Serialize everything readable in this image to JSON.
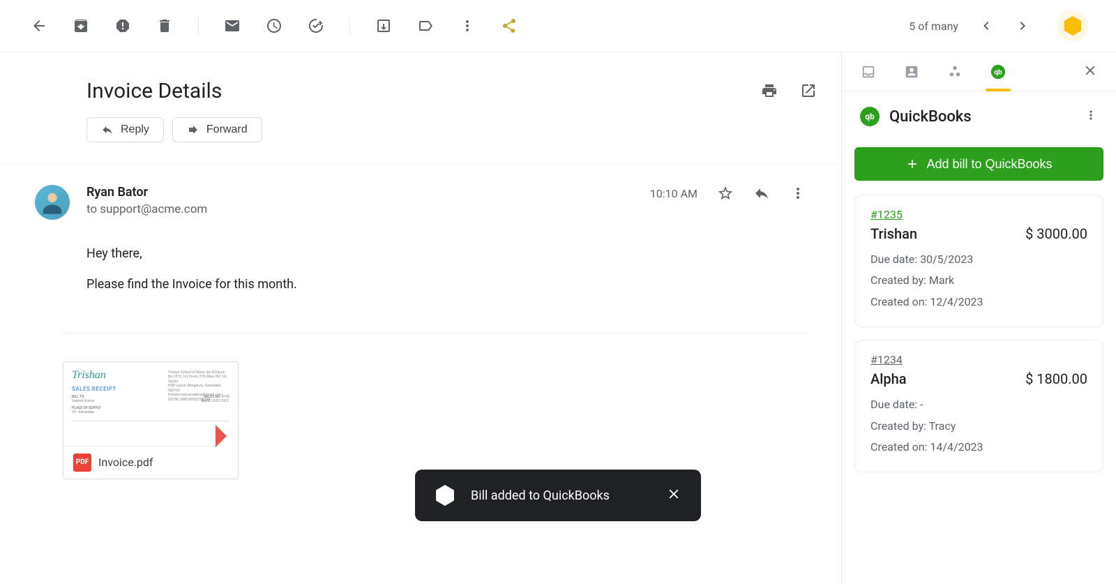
{
  "toolbar": {
    "counter": "5 of many"
  },
  "email": {
    "subject": "Invoice Details",
    "reply_label": "Reply",
    "forward_label": "Forward",
    "sender_name": "Ryan Bator",
    "recipient": "to support@acme.com",
    "timestamp": "10:10 AM",
    "body_line1": "Hey there,",
    "body_line2": "Please find the Invoice for this month.",
    "attachment": {
      "filename": "Invoice.pdf",
      "badge": "PDF",
      "preview_brand": "Trishan",
      "preview_title": "SALES RECEIPT",
      "preview_billto": "BILL TO",
      "preview_place": "PLACE OF SUPPLY"
    }
  },
  "sidepanel": {
    "title": "QuickBooks",
    "add_button": "Add bill to QuickBooks",
    "bills": [
      {
        "id": "#1235",
        "name": "Trishan",
        "amount": "$ 3000.00",
        "due": "Due date: 30/5/2023",
        "created_by": "Created by: Mark",
        "created_on": "Created on: 12/4/2023",
        "id_style": "green"
      },
      {
        "id": "#1234",
        "name": "Alpha",
        "amount": "$ 1800.00",
        "due": "Due date: -",
        "created_by": "Created by: Tracy",
        "created_on": "Created on: 14/4/2023",
        "id_style": "gray"
      }
    ]
  },
  "toast": {
    "message": "Bill added to QuickBooks"
  }
}
